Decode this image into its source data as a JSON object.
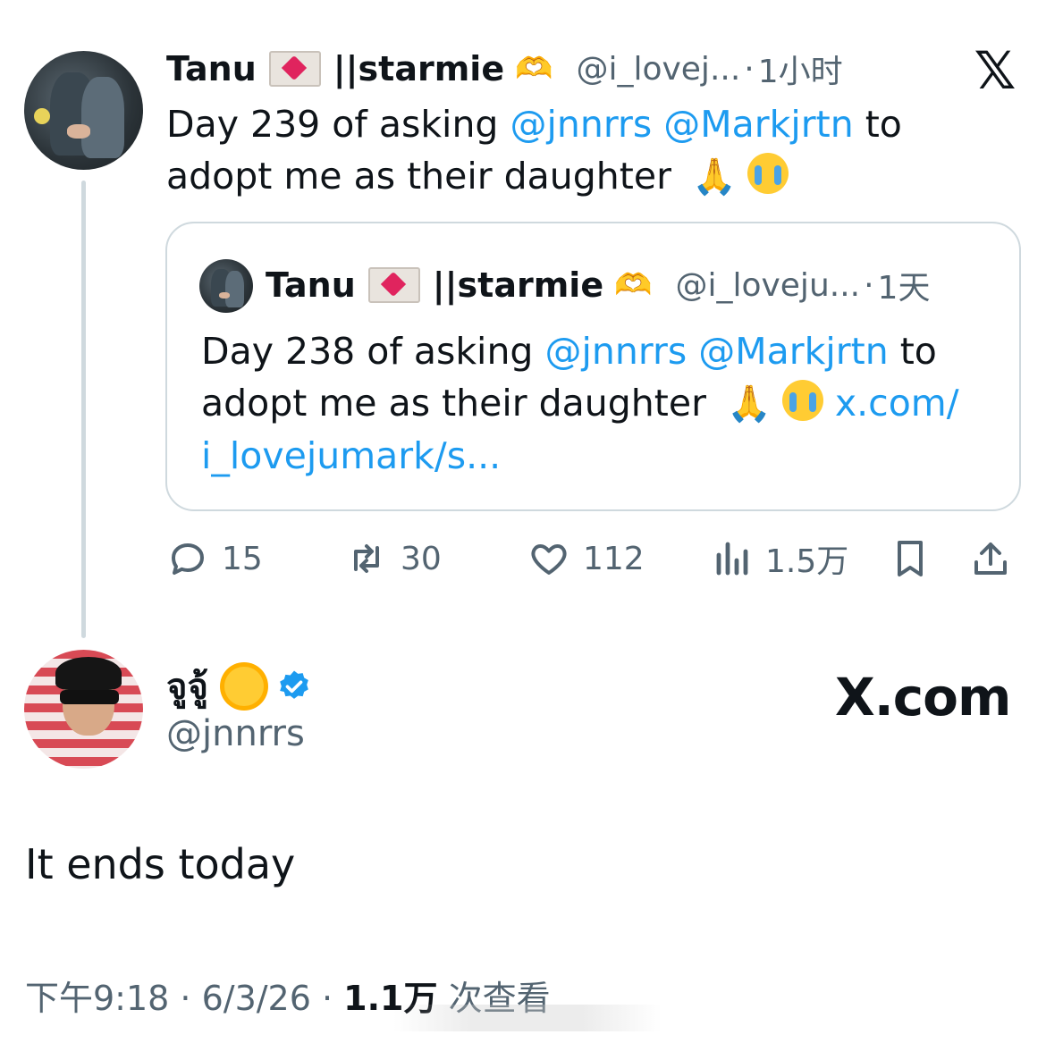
{
  "parent_tweet": {
    "display_name": "Tanu",
    "name_suffix": "||starmie",
    "handle": "@i_lovej...",
    "separator": "·",
    "time": "1小时",
    "text_parts": [
      {
        "text": "Day 239 of asking ",
        "type": "plain"
      },
      {
        "text": "@jnnrrs",
        "type": "mention"
      },
      {
        "text": " ",
        "type": "plain"
      },
      {
        "text": "@Markjrtn",
        "type": "mention"
      },
      {
        "text": " to adopt me as their daughter",
        "type": "plain"
      }
    ],
    "emojis": [
      "envelope-with-heart",
      "heart-hands",
      "folded-hands",
      "loudly-crying-face"
    ]
  },
  "quoted_tweet": {
    "display_name": "Tanu",
    "name_suffix": "||starmie",
    "handle": "@i_loveju...",
    "separator": "·",
    "time": "1天",
    "text_plain_1": "Day 238 of asking ",
    "mention_1": "@jnnrrs",
    "mention_2": "@Markjrtn",
    "text_plain_2": " to adopt me as their daughter",
    "link_1": "x.com/",
    "link_2": "i_lovejumark/s..."
  },
  "actions": {
    "reply_count": "15",
    "retweet_count": "30",
    "like_count": "112",
    "view_count": "1.5万"
  },
  "reply_tweet": {
    "display_name": "จูจู้",
    "handle": "@jnnrrs",
    "text": "It ends today",
    "meta_time": "下午9:18",
    "meta_sep": " · ",
    "meta_date": "6/3/26",
    "meta_views": "1.1万",
    "meta_views_label": " 次查看",
    "verified": true
  },
  "watermark_site": "X.com",
  "icons": [
    "x-logo-icon",
    "reply-icon",
    "retweet-icon",
    "like-icon",
    "views-icon",
    "bookmark-icon",
    "share-icon",
    "verified-badge-icon",
    "sun-emoji-icon"
  ],
  "colors": {
    "accent": "#1d9bf0",
    "secondary_text": "#536471",
    "border": "#cfd9de"
  }
}
